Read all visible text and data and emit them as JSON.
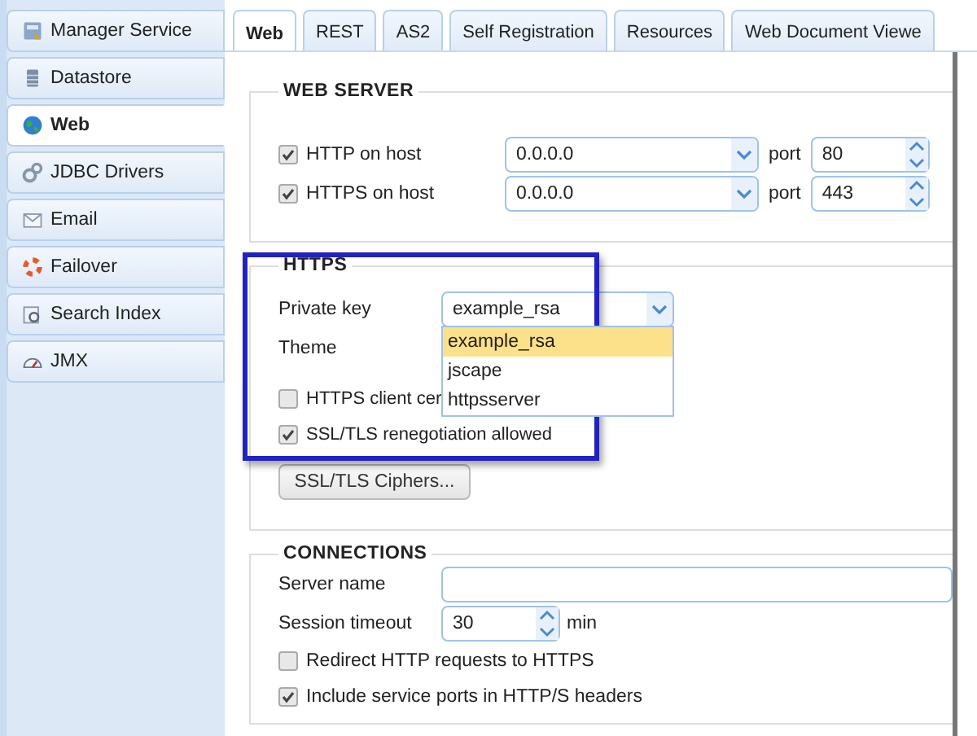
{
  "sidebar": {
    "items": [
      {
        "label": "Manager Service",
        "selected": false
      },
      {
        "label": "Datastore",
        "selected": false
      },
      {
        "label": "Web",
        "selected": true
      },
      {
        "label": "JDBC Drivers",
        "selected": false
      },
      {
        "label": "Email",
        "selected": false
      },
      {
        "label": "Failover",
        "selected": false
      },
      {
        "label": "Search Index",
        "selected": false
      },
      {
        "label": "JMX",
        "selected": false
      }
    ]
  },
  "tabs": [
    {
      "label": "Web",
      "selected": true
    },
    {
      "label": "REST",
      "selected": false
    },
    {
      "label": "AS2",
      "selected": false
    },
    {
      "label": "Self Registration",
      "selected": false
    },
    {
      "label": "Resources",
      "selected": false
    },
    {
      "label": "Web Document Viewe",
      "selected": false
    }
  ],
  "web_server": {
    "title": "WEB SERVER",
    "rows": [
      {
        "label": "HTTP on host",
        "checked": true,
        "host": "0.0.0.0",
        "port_label": "port",
        "port": "80"
      },
      {
        "label": "HTTPS on host",
        "checked": true,
        "host": "0.0.0.0",
        "port_label": "port",
        "port": "443"
      }
    ]
  },
  "https": {
    "title": "HTTPS",
    "private_key": {
      "label": "Private key",
      "value": "example_rsa",
      "options": [
        {
          "label": "example_rsa",
          "selected": true
        },
        {
          "label": "jscape",
          "selected": false
        },
        {
          "label": "httpsserver",
          "selected": false
        }
      ]
    },
    "theme": {
      "label": "Theme"
    },
    "checkboxes": [
      {
        "label": "HTTPS client cer",
        "checked": false
      },
      {
        "label": "SSL/TLS renegotiation allowed",
        "checked": true
      }
    ],
    "button": "SSL/TLS Ciphers..."
  },
  "connections": {
    "title": "CONNECTIONS",
    "server_name": {
      "label": "Server name"
    },
    "session_timeout": {
      "label": "Session timeout",
      "value": "30",
      "unit": "min"
    },
    "checkboxes": [
      {
        "label": "Redirect HTTP requests to HTTPS",
        "checked": false
      },
      {
        "label": "Include service ports in HTTP/S headers",
        "checked": true
      }
    ]
  }
}
